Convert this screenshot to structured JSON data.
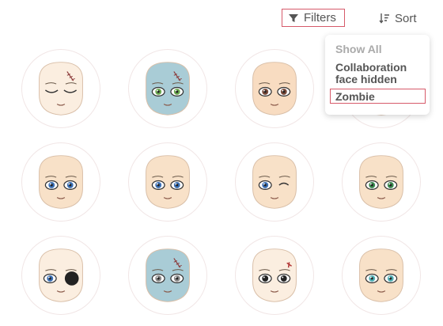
{
  "toolbar": {
    "filters_label": "Filters",
    "sort_label": "Sort"
  },
  "filter_menu": {
    "items": [
      {
        "label": "Show All",
        "state": "muted"
      },
      {
        "label": "Collaboration face hidden",
        "state": "normal"
      },
      {
        "label": "Zombie",
        "state": "selected"
      }
    ]
  },
  "faces": [
    {
      "skin": "#fbeee0",
      "eyes": "closed",
      "mark": "stitch-scar"
    },
    {
      "skin": "#a9ccd6",
      "eyes": "green-tired",
      "mark": "stitches"
    },
    {
      "skin": "#f8dcc1",
      "eyes": "brown-angry",
      "mark": "none"
    },
    {
      "skin": "#f8e1c8",
      "eyes": "hidden",
      "mark": "none"
    },
    {
      "skin": "#f8e1c8",
      "eyes": "blue",
      "mark": "none"
    },
    {
      "skin": "#f8e1c8",
      "eyes": "blue-sleepy",
      "mark": "none"
    },
    {
      "skin": "#f8e1c8",
      "eyes": "blue-wink",
      "mark": "none"
    },
    {
      "skin": "#f8e1c8",
      "eyes": "blue-green",
      "mark": "none"
    },
    {
      "skin": "#fbeee0",
      "eyes": "eyepatch",
      "mark": "none"
    },
    {
      "skin": "#a9ccd6",
      "eyes": "zombie-gray",
      "mark": "stitches"
    },
    {
      "skin": "#fbeee0",
      "eyes": "black-red",
      "mark": "cut"
    },
    {
      "skin": "#f8e1c8",
      "eyes": "teal",
      "mark": "none"
    }
  ],
  "colors": {
    "accent_outline": "#d65a6a",
    "muted_text": "#aaaaaa",
    "text": "#555555"
  }
}
